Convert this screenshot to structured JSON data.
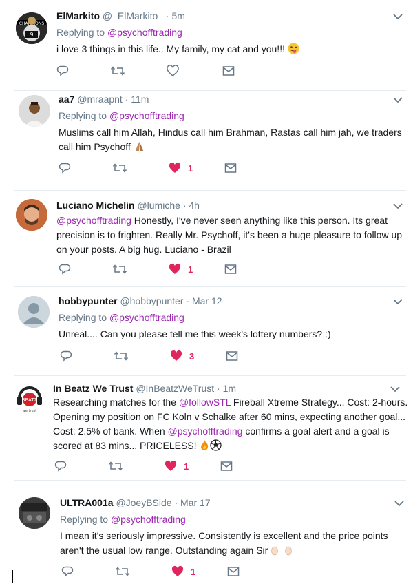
{
  "tweets": [
    {
      "name": "ElMarkito",
      "handle": "@_ElMarkito_",
      "time": "· 5m",
      "reply_prefix": "Replying to",
      "reply_handle": "@psychofftrading",
      "lines": [
        "i love 3 things in this life.. My family, my cat and you!!! "
      ],
      "liked": false,
      "likes": ""
    },
    {
      "name": "aa7",
      "handle": "@mraapnt",
      "time": "· 11m",
      "reply_prefix": "Replying to",
      "reply_handle": "@psychofftrading",
      "lines": [
        "Muslims call him Allah, Hindus call him Brahman, Rastas call him jah, we traders",
        "call him Psychoff "
      ],
      "liked": true,
      "likes": "1"
    },
    {
      "name": "Luciano Michelin",
      "handle": "@lumiche",
      "time": "· 4h",
      "mention_lead": "@psychofftrading",
      "lines": [
        " Honestly, I've never seen anything like this person. Its great",
        "precision is to frighten. Really Mr. Psychoff, it's been a huge pleasure to follow up",
        "on your posts. A big hug. Luciano - Brazil"
      ],
      "liked": true,
      "likes": "1"
    },
    {
      "name": "hobbypunter",
      "handle": "@hobbypunter",
      "time": "· Mar 12",
      "reply_prefix": "Replying to",
      "reply_handle": "@psychofftrading",
      "lines": [
        "Unreal.... Can you please tell me this week's lottery numbers? :)"
      ],
      "liked": true,
      "likes": "3"
    },
    {
      "name": "In Beatz We Trust",
      "handle": "@InBeatzWeTrust",
      "time": "· 1m",
      "line1_pre": "Researching matches for the ",
      "line1_mention": "@followSTL",
      "line1_post": " Fireball Xtreme Strategy... Cost: 2-hours.",
      "line2": "Opening my position on FC Koln v Schalke after 60 mins, expecting another goal...",
      "line3_pre": "Cost: 2.5% of bank. When ",
      "line3_mention": "@psychofftrading",
      "line3_post": " confirms a goal alert and a goal is",
      "line4": "scored at 83 mins... PRICELESS! ",
      "liked": true,
      "likes": "1"
    },
    {
      "name": "ULTRA001a",
      "handle": "@JoeyBSide",
      "time": "· Mar 17",
      "reply_prefix": "Replying to",
      "reply_handle": "@psychofftrading",
      "lines": [
        "I mean it's seriously impressive. Consistently is excellent and the price points",
        "aren't the usual low range. Outstanding again Sir "
      ],
      "liked": true,
      "likes": "1"
    }
  ],
  "colors": {
    "mention": "#9c27b0",
    "like": "#e0245e",
    "icon": "#657786",
    "divider": "#e6ecf0"
  },
  "icons": [
    "reply-icon",
    "retweet-icon",
    "heart-icon",
    "direct-message-icon",
    "chevron-down-icon"
  ]
}
